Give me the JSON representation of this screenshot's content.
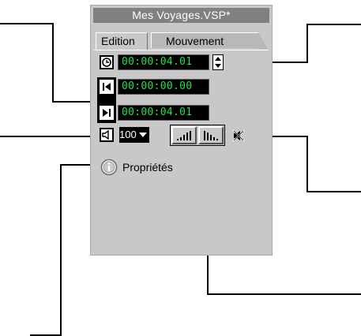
{
  "window": {
    "title": "Mes Voyages.VSP*"
  },
  "tabs": [
    {
      "label": "Edition",
      "active": true
    },
    {
      "label": "Mouvement",
      "active": false
    }
  ],
  "timers": {
    "duration": "00:00:04.01",
    "start": "00:00:00.00",
    "end": "00:00:04.01"
  },
  "volume": {
    "value": "100"
  },
  "properties": {
    "label": "Propriétés"
  },
  "icons": {
    "duration": "clock-icon",
    "start": "go-to-start-icon",
    "end": "go-to-end-icon",
    "volume": "speaker-icon",
    "fade_in": "fade-in-icon",
    "fade_out": "fade-out-icon",
    "mute": "mute-icon",
    "properties": "info-icon"
  },
  "colors": {
    "lcd_text": "#22e04a",
    "lcd_bg": "#000000",
    "panel": "#c8c8c8",
    "title_bar": "#808080"
  }
}
